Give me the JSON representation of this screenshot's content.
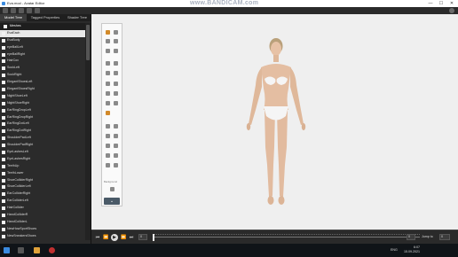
{
  "window": {
    "title": "Eva.mod - Avatar Editor",
    "watermark": "www.BANDICAM.com",
    "controls": [
      "—",
      "☐",
      "✕"
    ]
  },
  "toolbar": {
    "icons": [
      "folder-icon",
      "save-icon",
      "arrow-icon",
      "shield-icon",
      "globe-icon"
    ],
    "right_icons": [
      "help-icon"
    ]
  },
  "left_panel": {
    "tabs": [
      "Model Tree",
      "Tagged Properties",
      "Shader Tree"
    ],
    "active_tab": "Model Tree",
    "tree": [
      {
        "label": "Meshes",
        "group": true
      },
      {
        "label": "EvaEach",
        "selected": true
      },
      {
        "label": "EvaBody"
      },
      {
        "label": "eyeBallLeft"
      },
      {
        "label": "eyeBallRight"
      },
      {
        "label": "HairCox"
      },
      {
        "label": "SockLeft"
      },
      {
        "label": "SockRight"
      },
      {
        "label": "ElegantShoesLeft"
      },
      {
        "label": "ElegantShoesRight"
      },
      {
        "label": "NightShoeLeft"
      },
      {
        "label": "NightShoeRight"
      },
      {
        "label": "EarRingDropLeft"
      },
      {
        "label": "EarRingDropRight"
      },
      {
        "label": "EarRingDotLeft"
      },
      {
        "label": "EarRingDotRight"
      },
      {
        "label": "ShoulderPadLeft"
      },
      {
        "label": "ShoulderPadRight"
      },
      {
        "label": "EyeLashesLeft"
      },
      {
        "label": "EyeLashesRight"
      },
      {
        "label": "TeethUp"
      },
      {
        "label": "TeethLower"
      },
      {
        "label": "ShoeColliderRight"
      },
      {
        "label": "ShoeColliderLeft"
      },
      {
        "label": "EarColliderRight"
      },
      {
        "label": "EarColliderLeft"
      },
      {
        "label": "HairCollider"
      },
      {
        "label": "HandColliderR"
      },
      {
        "label": "HandColliderL"
      },
      {
        "label": "NewHowSportShoes"
      },
      {
        "label": "NewSneakersShoes"
      }
    ]
  },
  "palette": {
    "background_label": "Background",
    "collapse_glyph": "⌄"
  },
  "timeline": {
    "frame_value": "0",
    "end_value": "0",
    "jump_label": "Jump to",
    "jump_value": "0",
    "buttons": [
      "⏮",
      "⏪",
      "▶",
      "⏩",
      "⏭"
    ]
  },
  "taskbar": {
    "language": "ENG",
    "time": "6:07",
    "date": "15.09.2021"
  },
  "colors": {
    "viewport_bg": "#efefef",
    "panel_bg": "#2b2b2b",
    "accent": "#d28a2a"
  }
}
